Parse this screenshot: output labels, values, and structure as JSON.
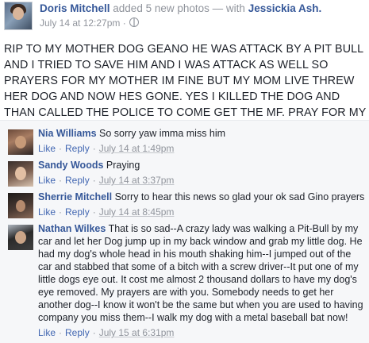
{
  "post": {
    "author": "Doris Mitchell",
    "action": "added 5 new photos —",
    "with_label": "with",
    "with_name": "Jessickia Ash.",
    "date": "July 14 at 12:27pm ·",
    "privacy_icon": "globe-icon",
    "text": "RIP TO MY MOTHER DOG GEANO HE WAS ATTACK BY A PIT BULL AND I TRIED TO SAVE HIM AND I WAS ATTACK AS WELL SO PRAYERS FOR MY MOTHER IM FINE BUT MY MOM LIVE THREW HER DOG AND NOW HES GONE. YES I KILLED THE DOG AND THAN CALLED THE POLICE TO COME GET THE MF. PRAY FOR MY MOTHER PLEASE"
  },
  "comments": [
    {
      "name": "Nia Williams",
      "text": "So sorry yaw imma miss him",
      "like": "Like",
      "reply": "Reply",
      "time": "July 14 at 1:49pm"
    },
    {
      "name": "Sandy Woods",
      "text": "Praying",
      "like": "Like",
      "reply": "Reply",
      "time": "July 14 at 3:37pm"
    },
    {
      "name": "Sherrie Mitchell",
      "text": "Sorry to hear this news so glad your ok sad Gino prayers",
      "like": "Like",
      "reply": "Reply",
      "time": "July 14 at 8:45pm"
    },
    {
      "name": "Nathan Wilkes",
      "text": "That is so sad--A crazy lady was walking a Pit-Bull by my car and let her Dog jump up in my back window and grab my little dog. He had my dog's whole head in his mouth shaking him--I jumped out of the car and stabbed that some of a bitch with a screw driver--It put one of my little dogs eye out. It cost me almost 2 thousand dollars to have my dog's eye removed. My prayers are with you. Somebody needs to get her another dog--I know it won't be the same but when you are used to having company you miss them--I walk my dog with a metal baseball bat now!",
      "like": "Like",
      "reply": "Reply",
      "time": "July 15 at 6:31pm"
    }
  ],
  "colors": {
    "link_blue": "#365899",
    "action_blue": "#4267b2",
    "meta_gray": "#90949c",
    "comments_bg": "#f6f7f9"
  }
}
